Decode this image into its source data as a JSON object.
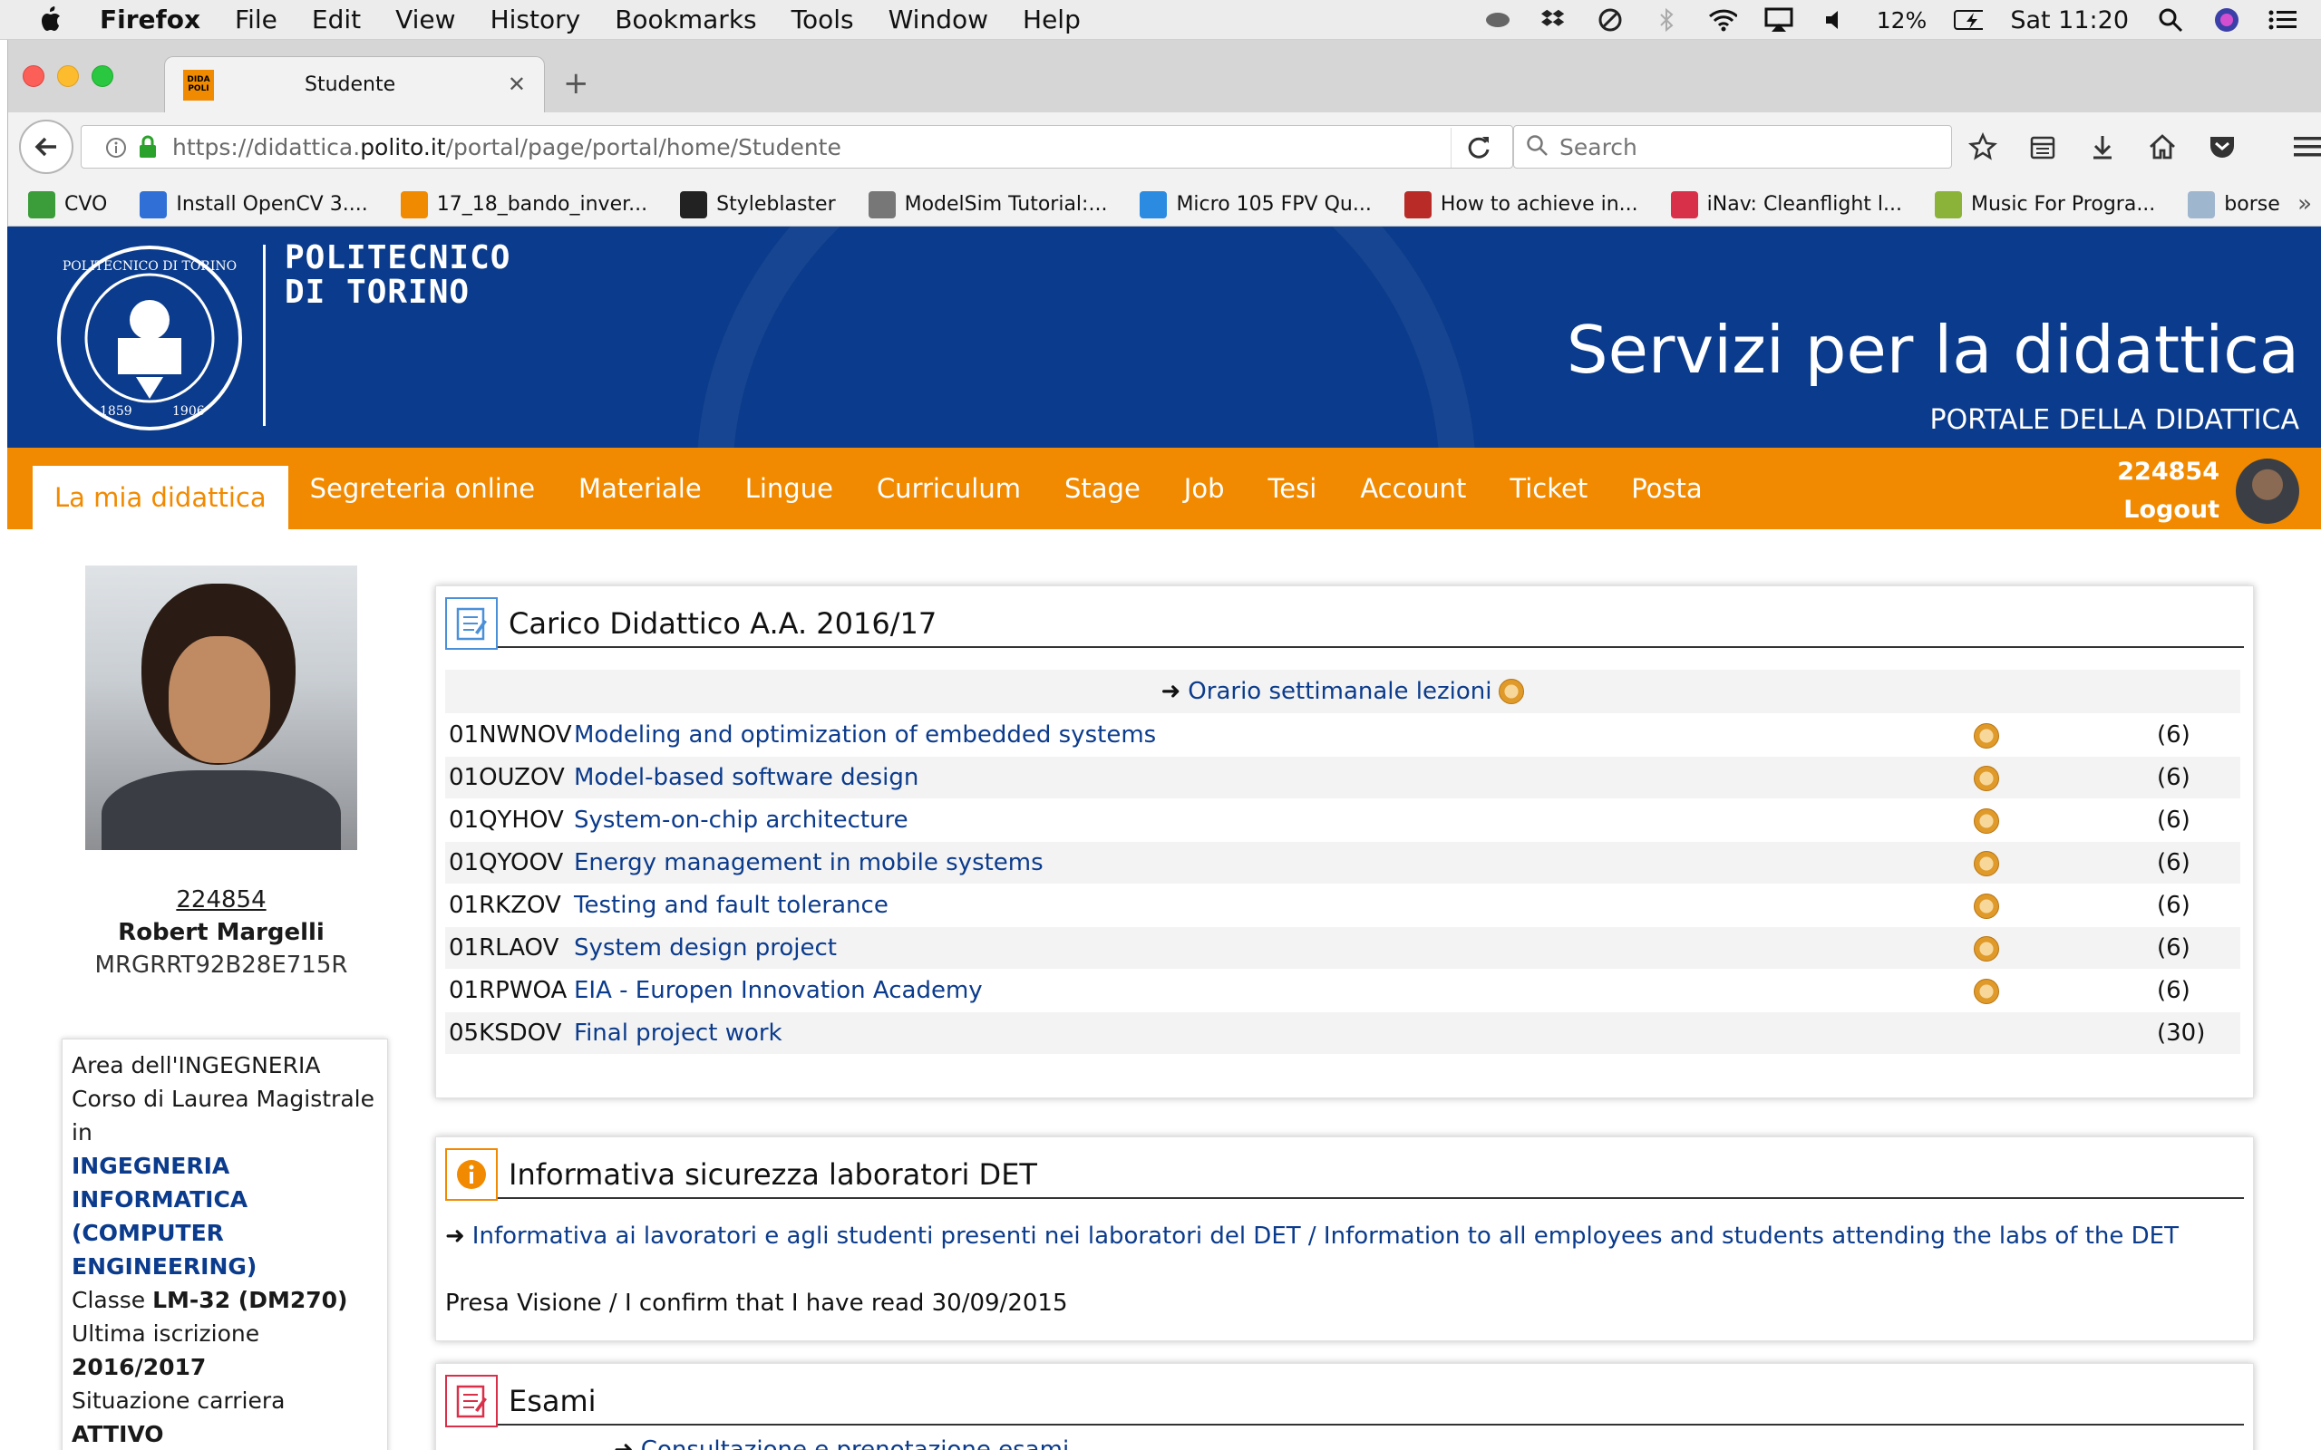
{
  "menubar": {
    "app": "Firefox",
    "items": [
      "File",
      "Edit",
      "View",
      "History",
      "Bookmarks",
      "Tools",
      "Window",
      "Help"
    ],
    "battery": "12%",
    "clock": "Sat 11:20"
  },
  "browser": {
    "tab_title": "Studente",
    "tab_favicon_text": "DIDA POLI",
    "url_prefix": "https://didattica.",
    "url_domain": "polito.it",
    "url_path": "/portal/page/portal/home/Studente",
    "search_placeholder": "Search",
    "bookmarks": [
      {
        "label": "CVO",
        "icon": "cvo-icon",
        "color": "#3a9d3a"
      },
      {
        "label": "Install OpenCV 3....",
        "icon": "p-icon",
        "color": "#2f6fd6"
      },
      {
        "label": "17_18_bando_inver...",
        "icon": "dida-icon",
        "color": "#f08a00"
      },
      {
        "label": "Styleblaster",
        "icon": "hat-icon",
        "color": "#222222"
      },
      {
        "label": "ModelSim Tutorial:...",
        "icon": "gear-icon",
        "color": "#777777"
      },
      {
        "label": "Micro 105 FPV Qu...",
        "icon": "t-icon",
        "color": "#2a8be0"
      },
      {
        "label": "How to achieve in...",
        "icon": "q-icon",
        "color": "#b92b27"
      },
      {
        "label": "iNav: Cleanflight l...",
        "icon": "inav-icon",
        "color": "#d9304a"
      },
      {
        "label": "Music For Progra...",
        "icon": "h-icon",
        "color": "#8bb33a"
      },
      {
        "label": "borse",
        "icon": "folder-icon",
        "color": "#9fb6cf"
      }
    ]
  },
  "banner": {
    "university_line1": "POLITECNICO",
    "university_line2": "DI TORINO",
    "title": "Servizi per la didattica",
    "subtitle": "PORTALE DELLA DIDATTICA"
  },
  "nav": {
    "items": [
      "La mia didattica",
      "Segreteria online",
      "Materiale",
      "Lingue",
      "Curriculum",
      "Stage",
      "Job",
      "Tesi",
      "Account",
      "Ticket",
      "Posta"
    ],
    "active": "La mia didattica",
    "user_id": "224854",
    "logout": "Logout"
  },
  "student": {
    "id": "224854",
    "name": "Robert Margelli",
    "fiscal_code": "MRGRRT92B28E715R",
    "area": "Area dell'INGEGNERIA",
    "course_type": "Corso di Laurea Magistrale in",
    "course_name": "INGEGNERIA INFORMATICA (COMPUTER ENGINEERING)",
    "class_label": "Classe",
    "class_value": "LM-32 (DM270)",
    "last_enrollment_label": "Ultima iscrizione",
    "last_enrollment_value": "2016/2017",
    "career_label": "Situazione carriera",
    "career_value": "ATTIVO"
  },
  "carico": {
    "title": "Carico Didattico A.A. 2016/17",
    "orario_link": "Orario settimanale lezioni",
    "courses": [
      {
        "code": "01NWNOV",
        "name": "Modeling and optimization of embedded systems",
        "clock": true,
        "cfu": "(6)"
      },
      {
        "code": "01OUZOV",
        "name": "Model-based software design",
        "clock": true,
        "cfu": "(6)"
      },
      {
        "code": "01QYHOV",
        "name": "System-on-chip architecture",
        "clock": true,
        "cfu": "(6)"
      },
      {
        "code": "01QYOOV",
        "name": "Energy management in mobile systems",
        "clock": true,
        "cfu": "(6)"
      },
      {
        "code": "01RKZOV",
        "name": "Testing and fault tolerance",
        "clock": true,
        "cfu": "(6)"
      },
      {
        "code": "01RLAOV",
        "name": "System design project",
        "clock": true,
        "cfu": "(6)"
      },
      {
        "code": "01RPWOA",
        "name": "EIA - Europen Innovation Academy",
        "clock": true,
        "cfu": "(6)"
      },
      {
        "code": "05KSDOV",
        "name": "Final project work",
        "clock": false,
        "cfu": "(30)"
      }
    ]
  },
  "sicurezza": {
    "title": "Informativa sicurezza laboratori DET",
    "link": "Informativa ai lavoratori e agli studenti presenti nei laboratori del DET / Information to all employees and students attending the labs of the DET",
    "confirm": "Presa Visione / I confirm that I have read 30/09/2015"
  },
  "esami": {
    "title": "Esami",
    "link1": "Consultazione e prenotazione esami"
  },
  "colors": {
    "brand_blue": "#0b3b8c",
    "brand_orange": "#f18a00"
  }
}
